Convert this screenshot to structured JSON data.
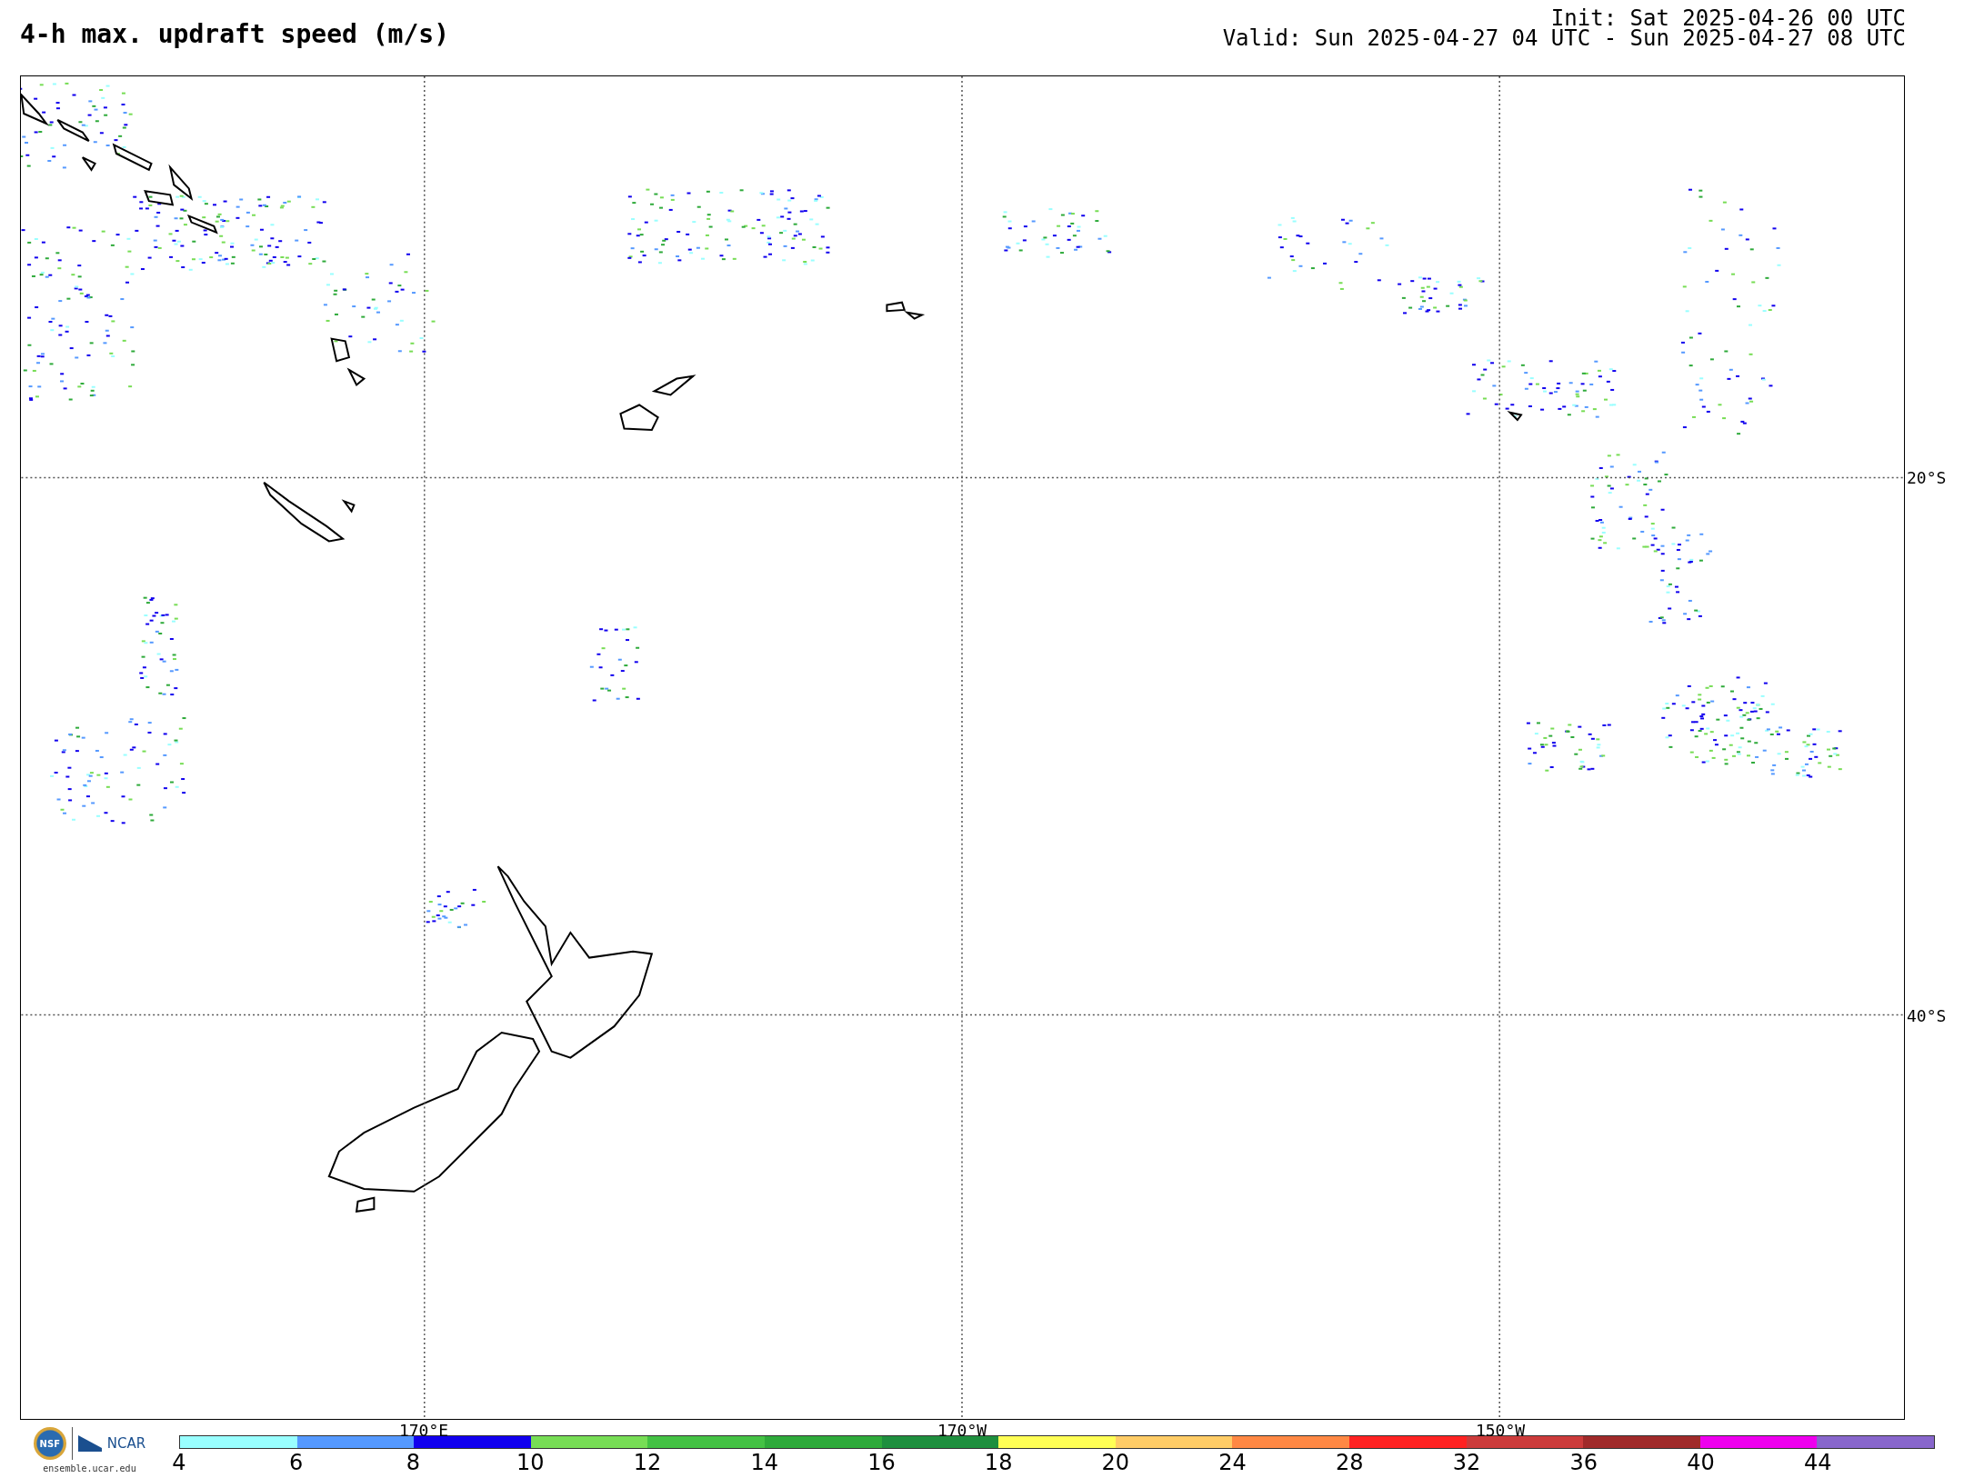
{
  "title": "4-h max. updraft speed (m/s)",
  "init": "Init: Sat 2025-04-26 00 UTC",
  "valid": "Valid: Sun 2025-04-27 04 UTC - Sun 2025-04-27 08 UTC",
  "map": {
    "lat_lines": [
      {
        "label": "20°S"
      },
      {
        "label": "40°S"
      }
    ],
    "lon_lines": [
      {
        "label": "170°E"
      },
      {
        "label": "170°W"
      },
      {
        "label": "150°W"
      }
    ]
  },
  "logo": {
    "nsf": "NSF",
    "ncar": "NCAR",
    "url": "ensemble.ucar.edu"
  },
  "colorbar": [
    {
      "label": "4",
      "color": "#99ffff"
    },
    {
      "label": "6",
      "color": "#5599ff"
    },
    {
      "label": "8",
      "color": "#1100ee"
    },
    {
      "label": "10",
      "color": "#77dd55"
    },
    {
      "label": "12",
      "color": "#44c244"
    },
    {
      "label": "14",
      "color": "#2eaa3a"
    },
    {
      "label": "16",
      "color": "#1e8f3e"
    },
    {
      "label": "18",
      "color": "#ffff55"
    },
    {
      "label": "20",
      "color": "#ffcc66"
    },
    {
      "label": "24",
      "color": "#ff8844"
    },
    {
      "label": "28",
      "color": "#ff2222"
    },
    {
      "label": "32",
      "color": "#cc3b3b"
    },
    {
      "label": "36",
      "color": "#a02a2a"
    },
    {
      "label": "40",
      "color": "#ee00ee"
    },
    {
      "label": "44",
      "color": "#8866cc"
    }
  ]
}
